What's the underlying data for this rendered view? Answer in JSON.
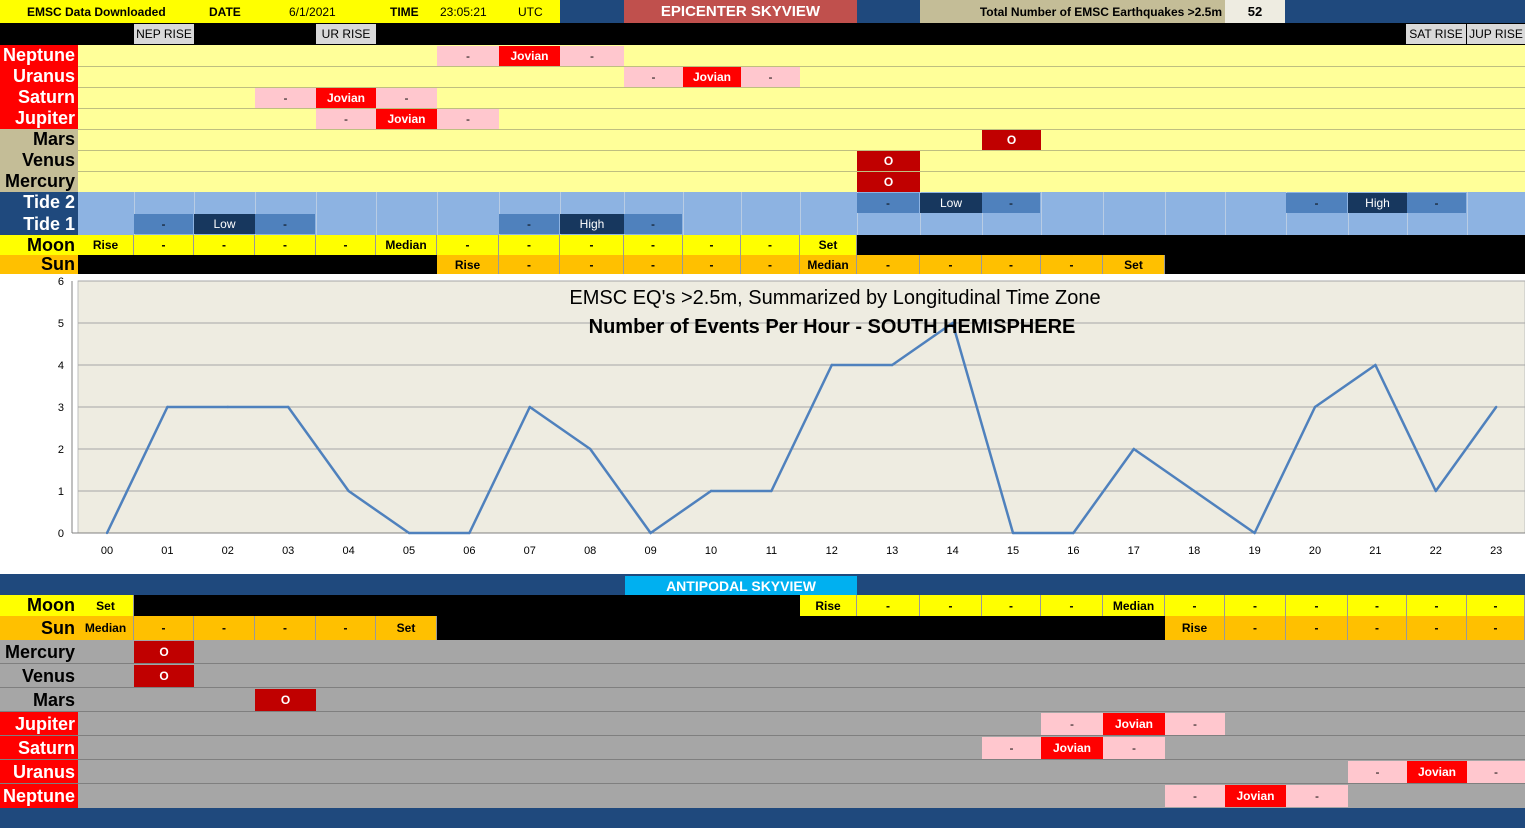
{
  "header": {
    "downloaded_label": "EMSC Data Downloaded",
    "date_label": "DATE",
    "date_value": "6/1/2021",
    "time_label": "TIME",
    "time_value": "23:05:21",
    "tz_label": "UTC",
    "title": "EPICENTER SKYVIEW",
    "total_label": "Total Number of EMSC Earthquakes >2.5m",
    "total_value": "52"
  },
  "rise_labels": {
    "nep": "NEP RISE",
    "ur": "UR RISE",
    "sat": "SAT RISE",
    "jup": "JUP RISE"
  },
  "top_rows": {
    "neptune": "Neptune",
    "uranus": "Uranus",
    "saturn": "Saturn",
    "jupiter": "Jupiter",
    "mars": "Mars",
    "venus": "Venus",
    "mercury": "Mercury",
    "tide2": "Tide 2",
    "tide1": "Tide 1",
    "moon": "Moon",
    "sun": "Sun"
  },
  "cells": {
    "jovian": "Jovian",
    "dash": "-",
    "o": "O",
    "low": "Low",
    "high": "High",
    "rise": "Rise",
    "set": "Set",
    "median": "Median"
  },
  "antipodal": {
    "title": "ANTIPODAL SKYVIEW",
    "moon": "Moon",
    "sun": "Sun",
    "mercury": "Mercury",
    "venus": "Venus",
    "mars": "Mars",
    "jupiter": "Jupiter",
    "saturn": "Saturn",
    "uranus": "Uranus",
    "neptune": "Neptune"
  },
  "colors": {
    "yellow_band": "#ffff99",
    "chart_bg": "#eeece1",
    "line": "#4f81bd",
    "grey_band": "#a6a6a6"
  },
  "chart_data": {
    "type": "line",
    "title": "EMSC EQ's >2.5m, Summarized by Longitudinal Time Zone",
    "subtitle": "Number of Events Per Hour - SOUTH HEMISPHERE",
    "xlabel": "",
    "ylabel": "",
    "ylim": [
      0,
      6
    ],
    "yticks": [
      "0",
      "1",
      "2",
      "3",
      "4",
      "5",
      "6"
    ],
    "grid": true,
    "categories": [
      "00",
      "01",
      "02",
      "03",
      "04",
      "05",
      "06",
      "07",
      "08",
      "09",
      "10",
      "11",
      "12",
      "13",
      "14",
      "15",
      "16",
      "17",
      "18",
      "19",
      "20",
      "21",
      "22",
      "23"
    ],
    "values": [
      0,
      3,
      3,
      3,
      1,
      0,
      0,
      3,
      2,
      0,
      1,
      1,
      4,
      4,
      5,
      0,
      0,
      2,
      1,
      0,
      3,
      4,
      1,
      3
    ]
  }
}
